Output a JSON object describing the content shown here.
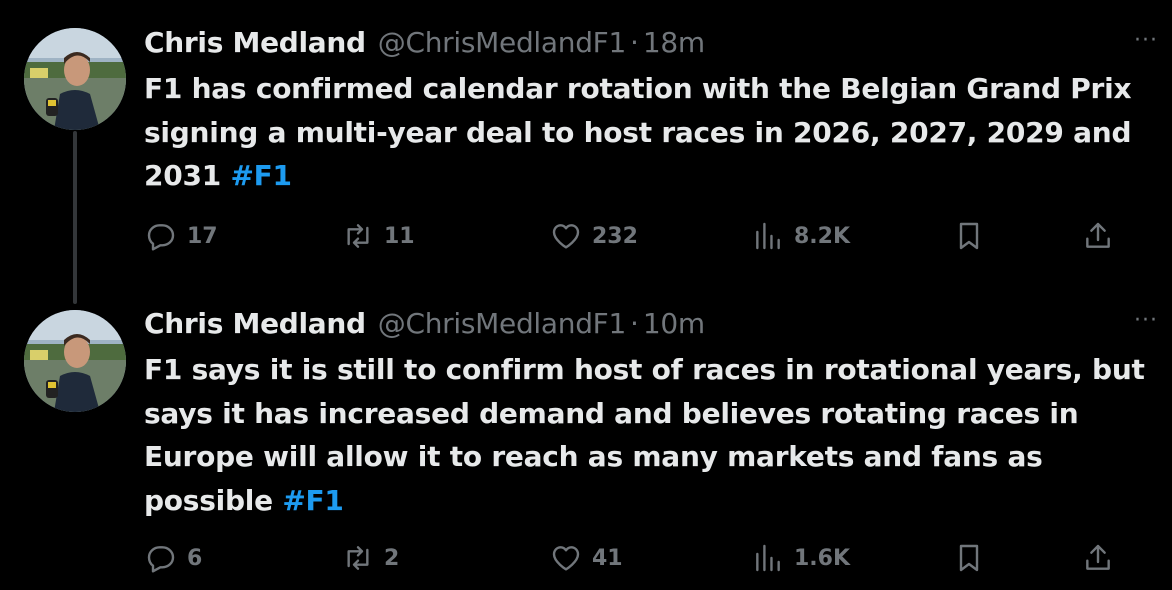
{
  "tweets": [
    {
      "name": "Chris Medland",
      "handle": "@ChrisMedlandF1",
      "separator": "·",
      "time": "18m",
      "text": "F1 has confirmed calendar rotation with the Belgian Grand Prix signing a multi-year deal to host races in 2026, 2027, 2029 and 2031 ",
      "hashtag": "#F1",
      "replies": "17",
      "reposts": "11",
      "likes": "232",
      "views": "8.2K"
    },
    {
      "name": "Chris Medland",
      "handle": "@ChrisMedlandF1",
      "separator": "·",
      "time": "10m",
      "text": "F1 says it is still to confirm host of races in rotational years, but says it has increased demand and believes rotating races in Europe will allow it to reach as many markets and fans as possible ",
      "hashtag": "#F1",
      "replies": "6",
      "reposts": "2",
      "likes": "41",
      "views": "1.6K"
    }
  ],
  "more_label": "···",
  "icons": {
    "reply": "reply-icon",
    "repost": "repost-icon",
    "like": "heart-icon",
    "views": "views-icon",
    "bookmark": "bookmark-icon",
    "share": "share-icon"
  },
  "colors": {
    "background": "#000000",
    "text": "#e7e9ea",
    "muted": "#71767b",
    "accent": "#1d9bf0",
    "thread_line": "#333639"
  }
}
